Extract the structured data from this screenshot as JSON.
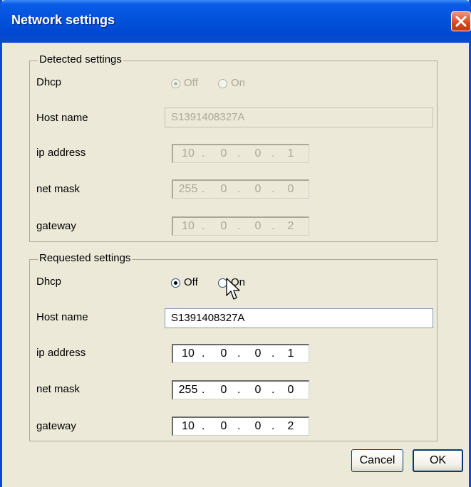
{
  "window": {
    "title": "Network settings"
  },
  "detected": {
    "group_label": "Detected settings",
    "dhcp": {
      "label": "Dhcp",
      "options": [
        "Off",
        "On"
      ],
      "selected": "Off"
    },
    "host_name": {
      "label": "Host name",
      "value": "S1391408327A"
    },
    "ip_address": {
      "label": "ip address",
      "octets": [
        "10",
        "0",
        "0",
        "1"
      ]
    },
    "net_mask": {
      "label": "net mask",
      "octets": [
        "255",
        "0",
        "0",
        "0"
      ]
    },
    "gateway": {
      "label": "gateway",
      "octets": [
        "10",
        "0",
        "0",
        "2"
      ]
    }
  },
  "requested": {
    "group_label": "Requested settings",
    "dhcp": {
      "label": "Dhcp",
      "options": [
        "Off",
        "On"
      ],
      "selected": "Off"
    },
    "host_name": {
      "label": "Host name",
      "value": "S1391408327A"
    },
    "ip_address": {
      "label": "ip address",
      "octets": [
        "10",
        "0",
        "0",
        "1"
      ]
    },
    "net_mask": {
      "label": "net mask",
      "octets": [
        "255",
        "0",
        "0",
        "0"
      ]
    },
    "gateway": {
      "label": "gateway",
      "octets": [
        "10",
        "0",
        "0",
        "2"
      ]
    }
  },
  "buttons": {
    "cancel": "Cancel",
    "ok": "OK"
  },
  "colors": {
    "titlebar": "#0252dc",
    "dialog_bg": "#ece9d8",
    "close": "#d9461c"
  },
  "icons": {
    "close": "close-icon",
    "cursor": "mouse-pointer-icon"
  }
}
